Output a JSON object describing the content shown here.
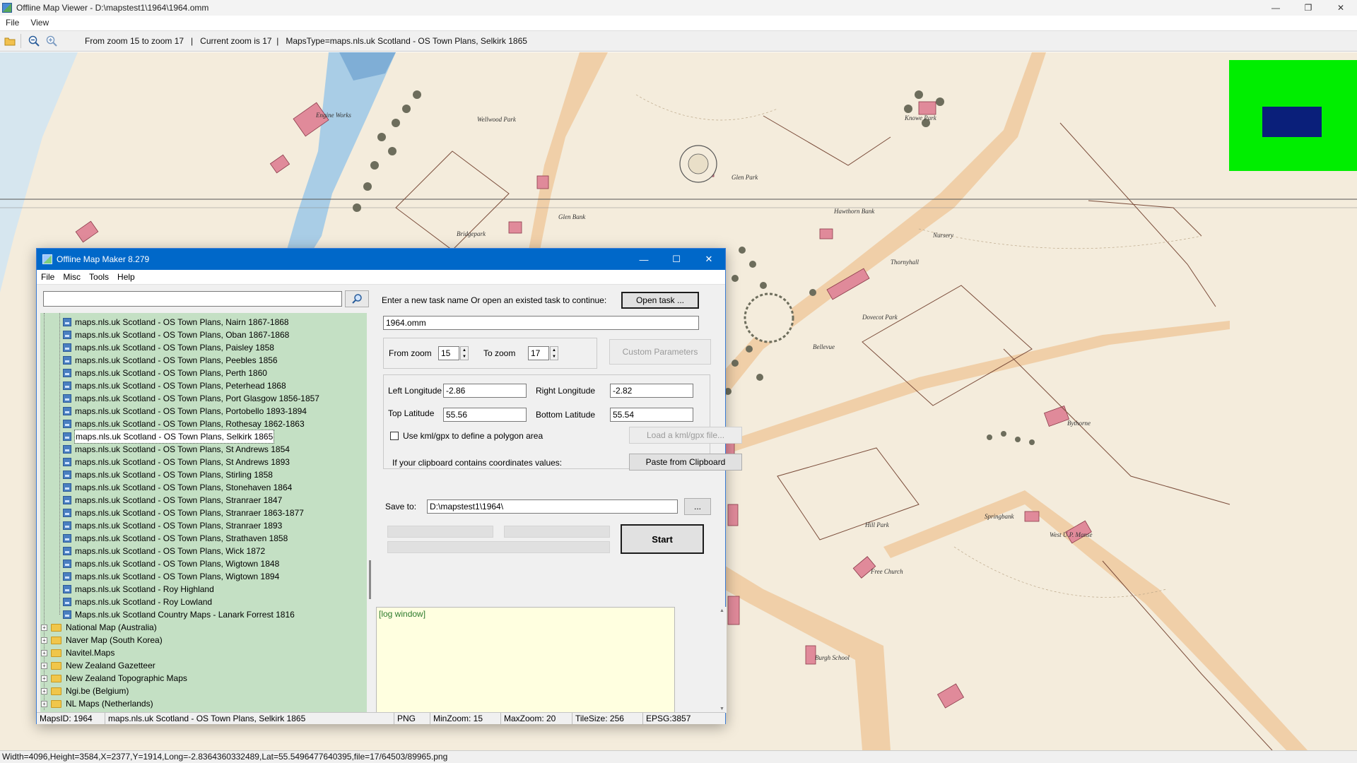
{
  "viewer": {
    "title": "Offline Map Viewer - D:\\mapstest1\\1964\\1964.omm",
    "menu": [
      "File",
      "View"
    ],
    "toolbar_info": "From zoom 15 to zoom 17   |   Current zoom is 17  |   MapsType=maps.nls.uk Scotland - OS Town Plans, Selkirk 1865",
    "status": "Width=4096,Height=3584,X=2377,Y=1914,Long=-2.8364360332489,Lat=55.5496477640395,file=17/64503/89965.png",
    "minimap_colors": {
      "background": "#00ee00",
      "viewport": "#0a1f7a"
    },
    "map_labels": [
      "Wellwood Park",
      "Glen Park",
      "Knowe Park",
      "Hawthorn Bank",
      "Bridgepark",
      "Glen Bank",
      "Thornyhall",
      "Nursery",
      "Dovecot Park",
      "Bellevue",
      "Bythorne",
      "Springbank",
      "Hill Park",
      "Free Church",
      "Burgh School",
      "West U.P. Manse",
      "Engine Works"
    ]
  },
  "dialog": {
    "title": "Offline Map Maker 8.279",
    "menu": [
      "File",
      "Misc",
      "Tools",
      "Help"
    ],
    "search_value": "",
    "tree_leaves": [
      "maps.nls.uk Scotland - OS Town Plans, Nairn 1867-1868",
      "maps.nls.uk Scotland - OS Town Plans, Oban 1867-1868",
      "maps.nls.uk Scotland - OS Town Plans, Paisley 1858",
      "maps.nls.uk Scotland - OS Town Plans, Peebles 1856",
      "maps.nls.uk Scotland - OS Town Plans, Perth 1860",
      "maps.nls.uk Scotland - OS Town Plans, Peterhead 1868",
      "maps.nls.uk Scotland - OS Town Plans, Port Glasgow 1856-1857",
      "maps.nls.uk Scotland - OS Town Plans, Portobello 1893-1894",
      "maps.nls.uk Scotland - OS Town Plans, Rothesay 1862-1863",
      "maps.nls.uk Scotland - OS Town Plans, Selkirk 1865",
      "maps.nls.uk Scotland - OS Town Plans, St Andrews 1854",
      "maps.nls.uk Scotland - OS Town Plans, St Andrews 1893",
      "maps.nls.uk Scotland - OS Town Plans, Stirling 1858",
      "maps.nls.uk Scotland - OS Town Plans, Stonehaven 1864",
      "maps.nls.uk Scotland - OS Town Plans, Stranraer 1847",
      "maps.nls.uk Scotland - OS Town Plans, Stranraer 1863-1877",
      "maps.nls.uk Scotland - OS Town Plans, Stranraer 1893",
      "maps.nls.uk Scotland - OS Town Plans, Strathaven 1858",
      "maps.nls.uk Scotland - OS Town Plans, Wick 1872",
      "maps.nls.uk Scotland - OS Town Plans, Wigtown 1848",
      "maps.nls.uk Scotland - OS Town Plans, Wigtown 1894",
      "maps.nls.uk Scotland - Roy Highland",
      "maps.nls.uk Scotland - Roy Lowland",
      "Maps.nls.uk Scotland Country Maps - Lanark Forrest 1816"
    ],
    "selected_index": 9,
    "tree_folders": [
      "National Map (Australia)",
      "Naver Map (South Korea)",
      "Navitel.Maps",
      "New Zealand Gazetteer",
      "New Zealand Topographic Maps",
      "Ngi.be (Belgium)",
      "NL Maps (Netherlands)"
    ],
    "task_prompt": "Enter a new task name Or open an existed task to continue:",
    "open_task_label": "Open task ...",
    "task_name": "1964.omm",
    "from_zoom_label": "From zoom",
    "from_zoom": "15",
    "to_zoom_label": "To zoom",
    "to_zoom": "17",
    "custom_params_label": "Custom Parameters",
    "left_lon_label": "Left Longitude",
    "left_lon": "-2.86",
    "right_lon_label": "Right Longitude",
    "right_lon": "-2.82",
    "top_lat_label": "Top Latitude",
    "top_lat": "55.56",
    "bottom_lat_label": "Bottom Latitude",
    "bottom_lat": "55.54",
    "kml_label": "Use kml/gpx to define a polygon area",
    "kml_checked": false,
    "load_kml_label": "Load a kml/gpx file...",
    "clipboard_prompt": "If your clipboard contains coordinates values:",
    "paste_label": "Paste from Clipboard",
    "save_to_label": "Save to:",
    "save_to": "D:\\mapstest1\\1964\\",
    "browse_label": "...",
    "start_label": "Start",
    "log_text": "[log window]",
    "status": {
      "maps_id": "MapsID: 1964",
      "map_name": "maps.nls.uk Scotland - OS Town Plans, Selkirk 1865",
      "format": "PNG",
      "min_zoom": "MinZoom: 15",
      "max_zoom": "MaxZoom: 20",
      "tile_size": "TileSize: 256",
      "epsg": "EPSG:3857"
    }
  }
}
